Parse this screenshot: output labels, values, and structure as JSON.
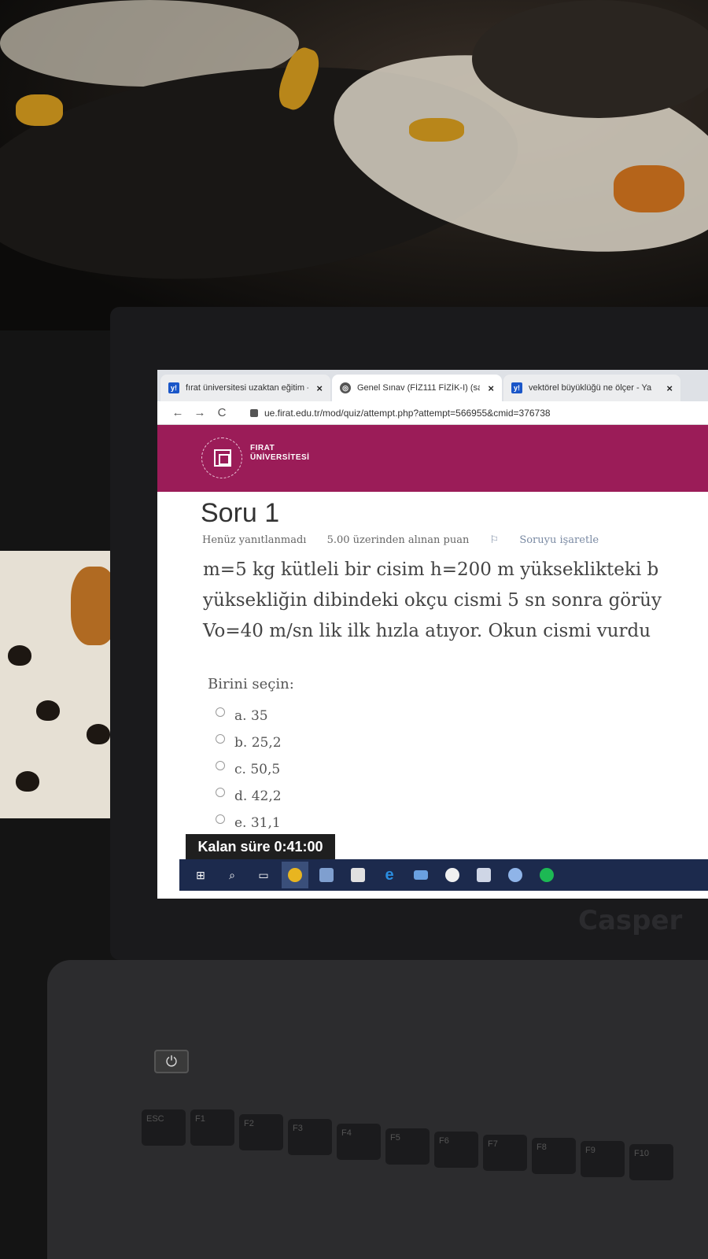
{
  "browser": {
    "tabs": [
      {
        "favicon": "yahoo-favicon",
        "title": "fırat üniversitesi uzaktan eğitim -"
      },
      {
        "favicon": "globe-favicon",
        "title": "Genel Sınav (FİZ111 FİZİK-I) (sayf"
      },
      {
        "favicon": "yahoo-favicon",
        "title": "vektörel büyüklüğü ne ölçer - Ya"
      }
    ],
    "close_glyph": "×",
    "url": "ue.firat.edu.tr/mod/quiz/attempt.php?attempt=566955&cmid=376738"
  },
  "header": {
    "logo_line1": "FIRAT",
    "logo_line2": "ÜNİVERSİTESİ"
  },
  "question": {
    "title": "Soru 1",
    "status": "Henüz yanıtlanmadı",
    "points": "5.00 üzerinden alınan puan",
    "flag_label": "Soruyu işaretle",
    "text_lines": [
      "m=5 kg kütleli bir cisim h=200 m yükseklikteki b",
      "yüksekliğin dibindeki okçu cismi 5 sn sonra görüy",
      "Vo=40 m/sn lik ilk hızla atıyor. Okun cismi vurdu"
    ],
    "choose_label": "Birini seçin:",
    "options": [
      "a. 35",
      "b. 25,2",
      "c. 50,5",
      "d. 42,2",
      "e. 31,1"
    ]
  },
  "timer": {
    "label": "Kalan süre",
    "value": "0:41:00"
  },
  "taskbar": {
    "icons": [
      "windows-start-icon",
      "search-icon",
      "task-view-icon",
      "chrome-icon",
      "file-explorer-icon",
      "store-icon",
      "edge-icon",
      "mail-icon",
      "yandex-icon",
      "cube-icon",
      "browser-icon",
      "spotify-icon"
    ]
  },
  "laptop": {
    "brand": "Casper",
    "keys": [
      "ESC",
      "F1",
      "F2",
      "F3",
      "F4",
      "F5",
      "F6",
      "F7",
      "F8",
      "F9",
      "F10"
    ]
  }
}
